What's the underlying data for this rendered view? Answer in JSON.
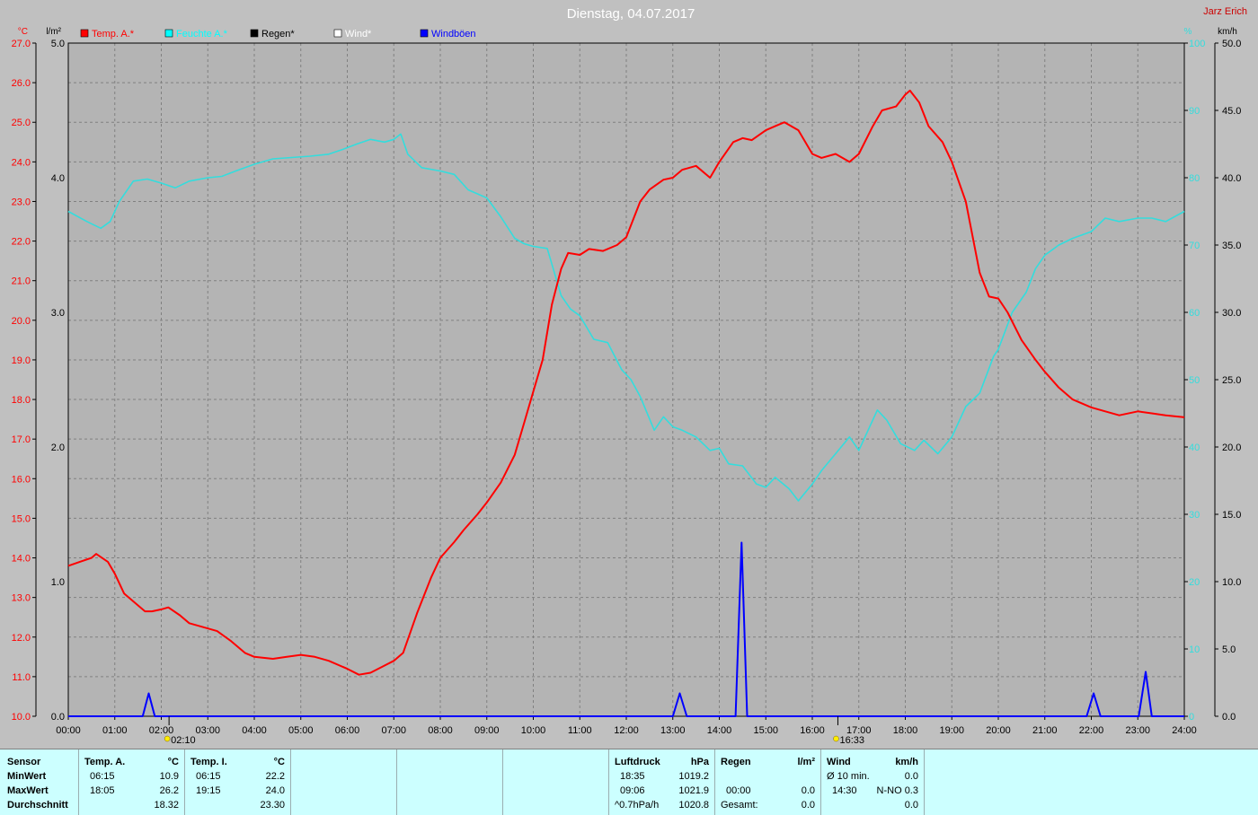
{
  "title": "Dienstag, 04.07.2017",
  "author": "Jarz Erich",
  "axes": {
    "left_unit": "°C",
    "left_unit2": "l/m²",
    "right_unit": "%",
    "right_unit2": "km/h",
    "temp_ticks": [
      "10.0",
      "11.0",
      "12.0",
      "13.0",
      "14.0",
      "15.0",
      "16.0",
      "17.0",
      "18.0",
      "19.0",
      "20.0",
      "21.0",
      "22.0",
      "23.0",
      "24.0",
      "25.0",
      "26.0",
      "27.0"
    ],
    "rain_ticks": [
      "0.0",
      "1.0",
      "2.0",
      "3.0",
      "4.0",
      "5.0"
    ],
    "hum_ticks": [
      "0",
      "10",
      "20",
      "30",
      "40",
      "50",
      "60",
      "70",
      "80",
      "90",
      "100"
    ],
    "wind_ticks": [
      "0.0",
      "5.0",
      "10.0",
      "15.0",
      "20.0",
      "25.0",
      "30.0",
      "35.0",
      "40.0",
      "45.0",
      "50.0"
    ],
    "time_ticks": [
      "00:00",
      "01:00",
      "02:00",
      "03:00",
      "04:00",
      "05:00",
      "06:00",
      "07:00",
      "08:00",
      "09:00",
      "10:00",
      "11:00",
      "12:00",
      "13:00",
      "14:00",
      "15:00",
      "16:00",
      "17:00",
      "18:00",
      "19:00",
      "20:00",
      "21:00",
      "22:00",
      "23:00",
      "24:00"
    ]
  },
  "legend": [
    {
      "label": "Temp. A.*",
      "color": "#ff0000"
    },
    {
      "label": "Feuchte A.*",
      "color": "#00ffff"
    },
    {
      "label": "Regen*",
      "color": "#000000"
    },
    {
      "label": "Wind*",
      "color": "#ffffff"
    },
    {
      "label": "Windböen",
      "color": "#0000ff"
    }
  ],
  "sun": {
    "sunrise": "02:10",
    "sunset": "16:33"
  },
  "colors": {
    "temperature": "#ff0000",
    "humidity": "#33dddd",
    "gusts": "#0000ff",
    "grid": "#808080",
    "plot_bg": "#b4b4b4"
  },
  "chart_data": {
    "type": "line",
    "title": "Dienstag, 04.07.2017",
    "x_unit": "hours",
    "xlim": [
      0,
      24
    ],
    "series": [
      {
        "name": "Temp. A.*",
        "unit": "°C",
        "axis": "temp",
        "ylim": [
          10,
          27
        ],
        "x": [
          0,
          0.25,
          0.5,
          0.6,
          0.85,
          1.0,
          1.2,
          1.5,
          1.65,
          1.8,
          2.0,
          2.15,
          2.4,
          2.6,
          2.9,
          3.2,
          3.5,
          3.8,
          4.0,
          4.4,
          4.7,
          5.0,
          5.3,
          5.6,
          6.0,
          6.25,
          6.5,
          6.75,
          7.0,
          7.2,
          7.5,
          7.8,
          8.0,
          8.3,
          8.5,
          8.8,
          9.0,
          9.3,
          9.6,
          9.8,
          10.0,
          10.2,
          10.4,
          10.6,
          10.75,
          11.0,
          11.2,
          11.5,
          11.8,
          12.0,
          12.3,
          12.5,
          12.8,
          13.0,
          13.2,
          13.5,
          13.8,
          14.0,
          14.3,
          14.5,
          14.7,
          15.0,
          15.2,
          15.4,
          15.7,
          16.0,
          16.2,
          16.5,
          16.8,
          17.0,
          17.3,
          17.5,
          17.8,
          18.0,
          18.1,
          18.3,
          18.5,
          18.8,
          19.0,
          19.3,
          19.6,
          19.8,
          20.0,
          20.2,
          20.5,
          20.8,
          21.0,
          21.3,
          21.6,
          22.0,
          22.3,
          22.6,
          23.0,
          23.3,
          23.6,
          24.0
        ],
        "y": [
          13.8,
          13.9,
          14.0,
          14.1,
          13.9,
          13.6,
          13.1,
          12.8,
          12.65,
          12.65,
          12.7,
          12.75,
          12.55,
          12.35,
          12.25,
          12.15,
          11.9,
          11.6,
          11.5,
          11.45,
          11.5,
          11.55,
          11.5,
          11.4,
          11.2,
          11.05,
          11.1,
          11.25,
          11.4,
          11.6,
          12.6,
          13.5,
          14.0,
          14.4,
          14.7,
          15.1,
          15.4,
          15.9,
          16.6,
          17.4,
          18.2,
          19.0,
          20.4,
          21.3,
          21.7,
          21.65,
          21.8,
          21.75,
          21.9,
          22.1,
          23.0,
          23.3,
          23.55,
          23.6,
          23.8,
          23.9,
          23.6,
          24.0,
          24.5,
          24.6,
          24.55,
          24.8,
          24.9,
          25.0,
          24.8,
          24.2,
          24.1,
          24.2,
          24.0,
          24.2,
          24.9,
          25.3,
          25.4,
          25.7,
          25.8,
          25.5,
          24.9,
          24.5,
          24.0,
          23.0,
          21.2,
          20.6,
          20.55,
          20.2,
          19.5,
          19.0,
          18.7,
          18.3,
          18.0,
          17.8,
          17.7,
          17.6,
          17.7,
          17.65,
          17.6,
          17.55
        ]
      },
      {
        "name": "Feuchte A.*",
        "unit": "%",
        "axis": "humidity",
        "ylim": [
          0,
          100
        ],
        "x": [
          0,
          0.4,
          0.7,
          0.9,
          1.1,
          1.4,
          1.7,
          2.0,
          2.3,
          2.6,
          3.0,
          3.3,
          3.6,
          4.0,
          4.4,
          4.8,
          5.2,
          5.6,
          5.9,
          6.2,
          6.5,
          6.8,
          7.0,
          7.15,
          7.3,
          7.6,
          8.0,
          8.3,
          8.6,
          9.0,
          9.3,
          9.6,
          9.8,
          10.0,
          10.3,
          10.6,
          10.8,
          11.0,
          11.3,
          11.6,
          11.9,
          12.1,
          12.3,
          12.6,
          12.8,
          13.0,
          13.2,
          13.5,
          13.8,
          14.0,
          14.2,
          14.5,
          14.8,
          15.0,
          15.2,
          15.5,
          15.7,
          16.0,
          16.2,
          16.5,
          16.8,
          17.0,
          17.2,
          17.4,
          17.6,
          17.9,
          18.2,
          18.4,
          18.7,
          19.0,
          19.3,
          19.6,
          19.9,
          20.0,
          20.3,
          20.6,
          20.8,
          21.0,
          21.3,
          21.6,
          22.0,
          22.3,
          22.6,
          23.0,
          23.3,
          23.6,
          24.0
        ],
        "y": [
          75,
          73.5,
          72.5,
          73.5,
          76.5,
          79.5,
          79.8,
          79.2,
          78.5,
          79.5,
          80,
          80.2,
          81,
          82,
          82.8,
          83,
          83.2,
          83.5,
          84.2,
          85,
          85.7,
          85.3,
          85.7,
          86.5,
          83.5,
          81.5,
          81,
          80.5,
          78.2,
          77,
          74.2,
          71,
          70.2,
          69.8,
          69.5,
          62.5,
          60.5,
          59.5,
          56,
          55.5,
          51.5,
          50,
          47.5,
          42.5,
          44.5,
          43,
          42.5,
          41.5,
          39.5,
          39.8,
          37.5,
          37.2,
          34.5,
          34,
          35.5,
          33.8,
          32,
          34.5,
          36.5,
          39,
          41.5,
          39.5,
          42.5,
          45.5,
          44,
          40.5,
          39.5,
          41,
          39,
          41.5,
          46,
          48,
          53.5,
          54.5,
          60,
          63,
          66.5,
          68.5,
          70,
          71,
          72,
          74,
          73.5,
          74,
          74,
          73.5,
          75
        ]
      },
      {
        "name": "Windböen",
        "unit": "km/h",
        "axis": "wind",
        "ylim": [
          0,
          50
        ],
        "x": [
          0,
          1.6,
          1.73,
          1.86,
          2.0,
          13.0,
          13.15,
          13.3,
          13.5,
          14.35,
          14.48,
          14.6,
          14.75,
          21.9,
          22.05,
          22.2,
          22.4,
          23.02,
          23.17,
          23.3,
          24.0
        ],
        "y": [
          0,
          0,
          1.7,
          0,
          0,
          0,
          1.7,
          0,
          0,
          0,
          12.9,
          0,
          0,
          0,
          1.7,
          0,
          0,
          0,
          3.3,
          0,
          0
        ]
      },
      {
        "name": "Regen*",
        "unit": "l/m²",
        "axis": "rain",
        "ylim": [
          0,
          5
        ],
        "x": [
          0,
          24
        ],
        "y": [
          0,
          0
        ]
      }
    ]
  },
  "stats": {
    "col1": {
      "header": "Sensor",
      "rows": [
        "MinWert",
        "MaxWert",
        "Durchschnitt"
      ]
    },
    "col2": {
      "header": "Temp. A.",
      "unit": "°C",
      "rows": [
        [
          "06:15",
          "10.9"
        ],
        [
          "18:05",
          "26.2"
        ],
        [
          "",
          "18.32"
        ]
      ]
    },
    "col3": {
      "header": "Temp. I.",
      "unit": "°C",
      "rows": [
        [
          "06:15",
          "22.2"
        ],
        [
          "19:15",
          "24.0"
        ],
        [
          "",
          "23.30"
        ]
      ]
    },
    "col4": {
      "header": "Luftdruck",
      "unit": "hPa",
      "rows": [
        [
          "18:35",
          "1019.2"
        ],
        [
          "09:06",
          "1021.9"
        ],
        [
          "^0.7hPa/h",
          "1020.8"
        ]
      ]
    },
    "col5": {
      "header": "Regen",
      "unit": "l/m²",
      "rows": [
        [
          "",
          ""
        ],
        [
          "00:00",
          "0.0"
        ],
        [
          "Gesamt:",
          "0.0"
        ]
      ]
    },
    "col6": {
      "header": "Wind",
      "unit": "km/h",
      "rows": [
        [
          "Ø 10 min.",
          "0.0"
        ],
        [
          "14:30",
          "N-NO 0.3"
        ],
        [
          "",
          "0.0"
        ]
      ]
    }
  }
}
